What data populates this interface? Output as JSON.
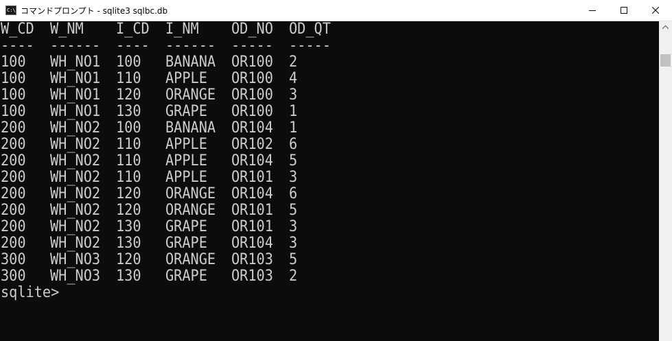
{
  "window": {
    "title": "コマンドプロンプト - sqlite3  sqlbc.db",
    "icon_text": "C:\\."
  },
  "title_buttons": {
    "minimize_icon": "minimize-icon",
    "maximize_icon": "maximize-icon",
    "close_icon": "close-icon"
  },
  "table": {
    "columns": [
      "W_CD",
      "W_NM",
      "I_CD",
      "I_NM",
      "OD_NO",
      "OD_QT"
    ],
    "separator": [
      "----",
      "------",
      "----",
      "------",
      "-----",
      "-----"
    ],
    "rows": [
      [
        "100",
        "WH_NO1",
        "100",
        "BANANA",
        "OR100",
        "2"
      ],
      [
        "100",
        "WH_NO1",
        "110",
        "APPLE",
        "OR100",
        "4"
      ],
      [
        "100",
        "WH_NO1",
        "120",
        "ORANGE",
        "OR100",
        "3"
      ],
      [
        "100",
        "WH_NO1",
        "130",
        "GRAPE",
        "OR100",
        "1"
      ],
      [
        "200",
        "WH_NO2",
        "100",
        "BANANA",
        "OR104",
        "1"
      ],
      [
        "200",
        "WH_NO2",
        "110",
        "APPLE",
        "OR102",
        "6"
      ],
      [
        "200",
        "WH_NO2",
        "110",
        "APPLE",
        "OR104",
        "5"
      ],
      [
        "200",
        "WH_NO2",
        "110",
        "APPLE",
        "OR101",
        "3"
      ],
      [
        "200",
        "WH_NO2",
        "120",
        "ORANGE",
        "OR104",
        "6"
      ],
      [
        "200",
        "WH_NO2",
        "120",
        "ORANGE",
        "OR101",
        "5"
      ],
      [
        "200",
        "WH_NO2",
        "130",
        "GRAPE",
        "OR101",
        "3"
      ],
      [
        "200",
        "WH_NO2",
        "130",
        "GRAPE",
        "OR104",
        "3"
      ],
      [
        "300",
        "WH_NO3",
        "120",
        "ORANGE",
        "OR103",
        "5"
      ],
      [
        "300",
        "WH_NO3",
        "130",
        "GRAPE",
        "OR103",
        "2"
      ]
    ]
  },
  "prompt": "sqlite>",
  "colors": {
    "console_bg": "#0c0c0c",
    "console_fg": "#cccccc",
    "titlebar_bg": "#ffffff",
    "scrollbar_bg": "#f0f0f0"
  }
}
